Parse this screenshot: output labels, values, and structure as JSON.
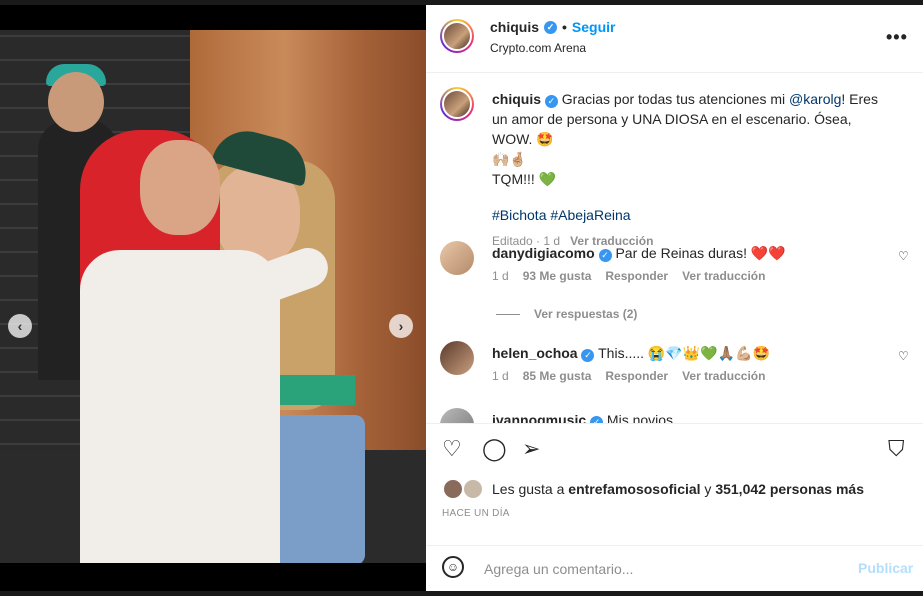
{
  "post": {
    "username": "chiquis",
    "follow_label": "Seguir",
    "separator": "•",
    "location": "Crypto.com Arena",
    "more_label": "•••"
  },
  "caption": {
    "username": "chiquis",
    "text_before_mention": "Gracias por todas tus atenciones mi ",
    "mention": "@karolg",
    "text_after_mention": "! Eres un amor de persona y UNA DIOSA en el escenario. Ósea, WOW. 🤩",
    "line2": "🙌🏼🤞🏼",
    "line3": "TQM!!! 💚",
    "hashtags": [
      "#Bichota",
      "#AbejaReina"
    ],
    "edited": "Editado · 1 d",
    "see_translation": "Ver traducción"
  },
  "comments": [
    {
      "username": "danydigiacomo",
      "text": "Par de Reinas duras! ❤️❤️",
      "time": "1 d",
      "likes": "93 Me gusta",
      "reply": "Responder",
      "translate": "Ver traducción"
    },
    {
      "username": "helen_ochoa",
      "text": "This..... 😭💎👑💚🙏🏽💪🏼🤩",
      "time": "1 d",
      "likes": "85 Me gusta",
      "reply": "Responder",
      "translate": "Ver traducción"
    },
    {
      "username": "ivannogmusic",
      "text": "Mis novios"
    }
  ],
  "view_replies": "Ver respuestas (2)",
  "likes": {
    "prefix": "Les gusta a ",
    "user": "entrefamososoficial",
    "middle": " y ",
    "count": "351,042 personas más"
  },
  "time_ago": "HACE UN DÍA",
  "add_comment": {
    "placeholder": "Agrega un comentario...",
    "publish": "Publicar"
  },
  "carousel": {
    "dots": 7,
    "active_dot": 1
  },
  "colors": {
    "link_blue": "#0095f6",
    "verified": "#3797f0",
    "publish_disabled": "#b2dffc"
  }
}
